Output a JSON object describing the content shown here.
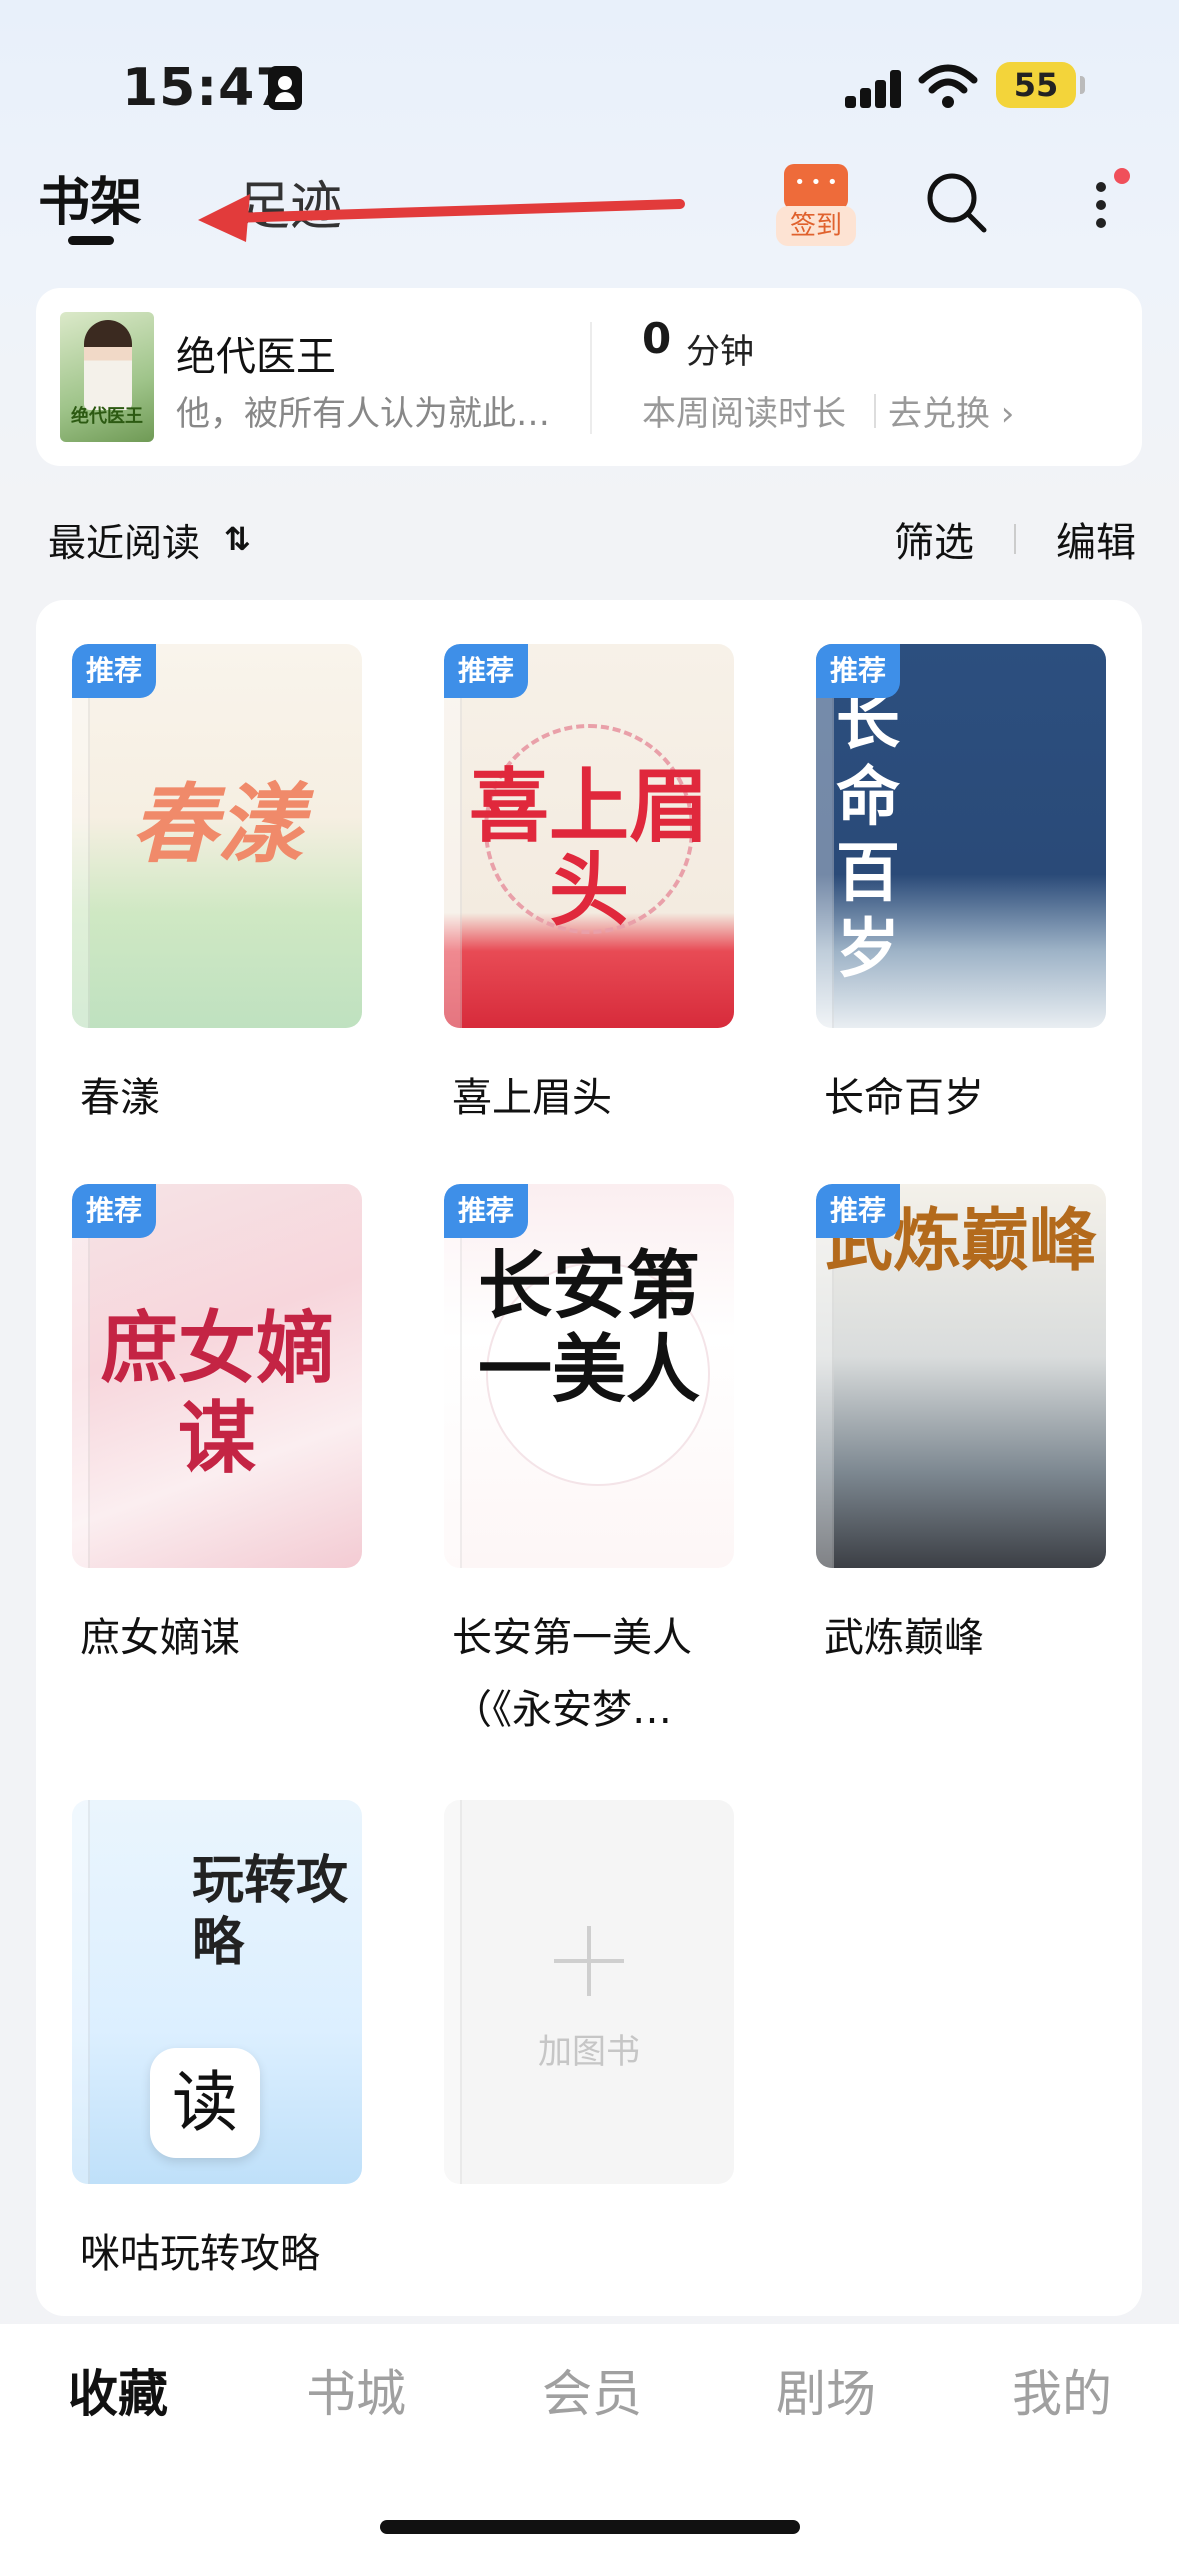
{
  "status_bar": {
    "time": "15:47",
    "battery": "55"
  },
  "top_tabs": {
    "shelf": "书架",
    "footprint": "足迹"
  },
  "top_actions": {
    "checkin": "签到"
  },
  "current_book": {
    "title": "绝代医王",
    "description": "他，被所有人认为就此…",
    "cover_text": "绝代医王"
  },
  "reading_stats": {
    "minutes": "0",
    "unit": "分钟",
    "label": "本周阅读时长",
    "exchange": "去兑换 ›"
  },
  "list_header": {
    "recent": "最近阅读",
    "sort_glyph": "⇅",
    "filter": "筛选",
    "edit": "编辑"
  },
  "books": [
    {
      "name": "春漾",
      "badge": "推荐",
      "cover_text": "春漾"
    },
    {
      "name": "喜上眉头",
      "badge": "推荐",
      "cover_text": "喜上眉头"
    },
    {
      "name": "长命百岁",
      "badge": "推荐",
      "cover_text": "长命百岁"
    },
    {
      "name": "庶女嫡谋",
      "badge": "推荐",
      "cover_text": "庶女嫡谋"
    },
    {
      "name": "长安第一美人（《永安梦…",
      "badge": "推荐",
      "cover_text": "长安第一美人"
    },
    {
      "name": "武炼巅峰",
      "badge": "推荐",
      "cover_text": "武炼巅峰"
    },
    {
      "name": "咪咕玩转攻略",
      "badge": "",
      "cover_text": "玩转攻略",
      "icon_text": "读"
    }
  ],
  "add_book": {
    "label": "加图书"
  },
  "bottom_nav": {
    "items": [
      "收藏",
      "书城",
      "会员",
      "剧场",
      "我的"
    ],
    "active": "收藏"
  },
  "colors": {
    "badge": "#3e8fe8",
    "checkin": "#ee6b3a",
    "annotation_arrow": "#e23b3b"
  }
}
